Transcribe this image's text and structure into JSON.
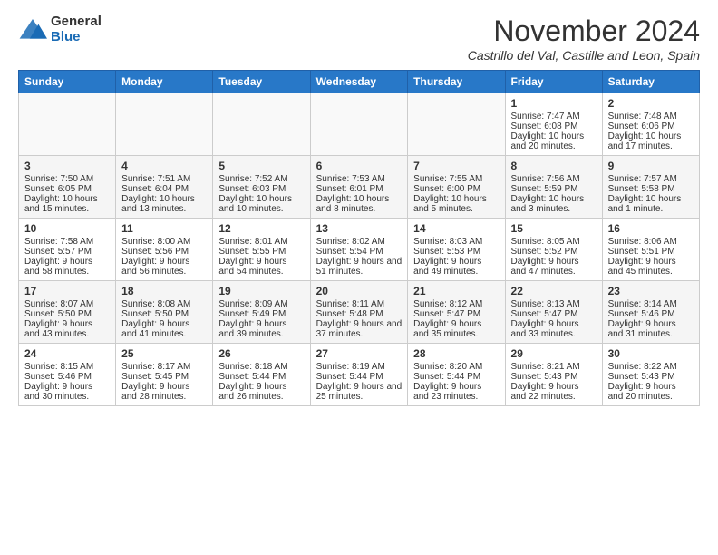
{
  "logo": {
    "general": "General",
    "blue": "Blue"
  },
  "header": {
    "month": "November 2024",
    "location": "Castrillo del Val, Castille and Leon, Spain"
  },
  "weekdays": [
    "Sunday",
    "Monday",
    "Tuesday",
    "Wednesday",
    "Thursday",
    "Friday",
    "Saturday"
  ],
  "weeks": [
    [
      {
        "day": "",
        "sunrise": "",
        "sunset": "",
        "daylight": ""
      },
      {
        "day": "",
        "sunrise": "",
        "sunset": "",
        "daylight": ""
      },
      {
        "day": "",
        "sunrise": "",
        "sunset": "",
        "daylight": ""
      },
      {
        "day": "",
        "sunrise": "",
        "sunset": "",
        "daylight": ""
      },
      {
        "day": "",
        "sunrise": "",
        "sunset": "",
        "daylight": ""
      },
      {
        "day": "1",
        "sunrise": "Sunrise: 7:47 AM",
        "sunset": "Sunset: 6:08 PM",
        "daylight": "Daylight: 10 hours and 20 minutes."
      },
      {
        "day": "2",
        "sunrise": "Sunrise: 7:48 AM",
        "sunset": "Sunset: 6:06 PM",
        "daylight": "Daylight: 10 hours and 17 minutes."
      }
    ],
    [
      {
        "day": "3",
        "sunrise": "Sunrise: 7:50 AM",
        "sunset": "Sunset: 6:05 PM",
        "daylight": "Daylight: 10 hours and 15 minutes."
      },
      {
        "day": "4",
        "sunrise": "Sunrise: 7:51 AM",
        "sunset": "Sunset: 6:04 PM",
        "daylight": "Daylight: 10 hours and 13 minutes."
      },
      {
        "day": "5",
        "sunrise": "Sunrise: 7:52 AM",
        "sunset": "Sunset: 6:03 PM",
        "daylight": "Daylight: 10 hours and 10 minutes."
      },
      {
        "day": "6",
        "sunrise": "Sunrise: 7:53 AM",
        "sunset": "Sunset: 6:01 PM",
        "daylight": "Daylight: 10 hours and 8 minutes."
      },
      {
        "day": "7",
        "sunrise": "Sunrise: 7:55 AM",
        "sunset": "Sunset: 6:00 PM",
        "daylight": "Daylight: 10 hours and 5 minutes."
      },
      {
        "day": "8",
        "sunrise": "Sunrise: 7:56 AM",
        "sunset": "Sunset: 5:59 PM",
        "daylight": "Daylight: 10 hours and 3 minutes."
      },
      {
        "day": "9",
        "sunrise": "Sunrise: 7:57 AM",
        "sunset": "Sunset: 5:58 PM",
        "daylight": "Daylight: 10 hours and 1 minute."
      }
    ],
    [
      {
        "day": "10",
        "sunrise": "Sunrise: 7:58 AM",
        "sunset": "Sunset: 5:57 PM",
        "daylight": "Daylight: 9 hours and 58 minutes."
      },
      {
        "day": "11",
        "sunrise": "Sunrise: 8:00 AM",
        "sunset": "Sunset: 5:56 PM",
        "daylight": "Daylight: 9 hours and 56 minutes."
      },
      {
        "day": "12",
        "sunrise": "Sunrise: 8:01 AM",
        "sunset": "Sunset: 5:55 PM",
        "daylight": "Daylight: 9 hours and 54 minutes."
      },
      {
        "day": "13",
        "sunrise": "Sunrise: 8:02 AM",
        "sunset": "Sunset: 5:54 PM",
        "daylight": "Daylight: 9 hours and 51 minutes."
      },
      {
        "day": "14",
        "sunrise": "Sunrise: 8:03 AM",
        "sunset": "Sunset: 5:53 PM",
        "daylight": "Daylight: 9 hours and 49 minutes."
      },
      {
        "day": "15",
        "sunrise": "Sunrise: 8:05 AM",
        "sunset": "Sunset: 5:52 PM",
        "daylight": "Daylight: 9 hours and 47 minutes."
      },
      {
        "day": "16",
        "sunrise": "Sunrise: 8:06 AM",
        "sunset": "Sunset: 5:51 PM",
        "daylight": "Daylight: 9 hours and 45 minutes."
      }
    ],
    [
      {
        "day": "17",
        "sunrise": "Sunrise: 8:07 AM",
        "sunset": "Sunset: 5:50 PM",
        "daylight": "Daylight: 9 hours and 43 minutes."
      },
      {
        "day": "18",
        "sunrise": "Sunrise: 8:08 AM",
        "sunset": "Sunset: 5:50 PM",
        "daylight": "Daylight: 9 hours and 41 minutes."
      },
      {
        "day": "19",
        "sunrise": "Sunrise: 8:09 AM",
        "sunset": "Sunset: 5:49 PM",
        "daylight": "Daylight: 9 hours and 39 minutes."
      },
      {
        "day": "20",
        "sunrise": "Sunrise: 8:11 AM",
        "sunset": "Sunset: 5:48 PM",
        "daylight": "Daylight: 9 hours and 37 minutes."
      },
      {
        "day": "21",
        "sunrise": "Sunrise: 8:12 AM",
        "sunset": "Sunset: 5:47 PM",
        "daylight": "Daylight: 9 hours and 35 minutes."
      },
      {
        "day": "22",
        "sunrise": "Sunrise: 8:13 AM",
        "sunset": "Sunset: 5:47 PM",
        "daylight": "Daylight: 9 hours and 33 minutes."
      },
      {
        "day": "23",
        "sunrise": "Sunrise: 8:14 AM",
        "sunset": "Sunset: 5:46 PM",
        "daylight": "Daylight: 9 hours and 31 minutes."
      }
    ],
    [
      {
        "day": "24",
        "sunrise": "Sunrise: 8:15 AM",
        "sunset": "Sunset: 5:46 PM",
        "daylight": "Daylight: 9 hours and 30 minutes."
      },
      {
        "day": "25",
        "sunrise": "Sunrise: 8:17 AM",
        "sunset": "Sunset: 5:45 PM",
        "daylight": "Daylight: 9 hours and 28 minutes."
      },
      {
        "day": "26",
        "sunrise": "Sunrise: 8:18 AM",
        "sunset": "Sunset: 5:44 PM",
        "daylight": "Daylight: 9 hours and 26 minutes."
      },
      {
        "day": "27",
        "sunrise": "Sunrise: 8:19 AM",
        "sunset": "Sunset: 5:44 PM",
        "daylight": "Daylight: 9 hours and 25 minutes."
      },
      {
        "day": "28",
        "sunrise": "Sunrise: 8:20 AM",
        "sunset": "Sunset: 5:44 PM",
        "daylight": "Daylight: 9 hours and 23 minutes."
      },
      {
        "day": "29",
        "sunrise": "Sunrise: 8:21 AM",
        "sunset": "Sunset: 5:43 PM",
        "daylight": "Daylight: 9 hours and 22 minutes."
      },
      {
        "day": "30",
        "sunrise": "Sunrise: 8:22 AM",
        "sunset": "Sunset: 5:43 PM",
        "daylight": "Daylight: 9 hours and 20 minutes."
      }
    ]
  ]
}
